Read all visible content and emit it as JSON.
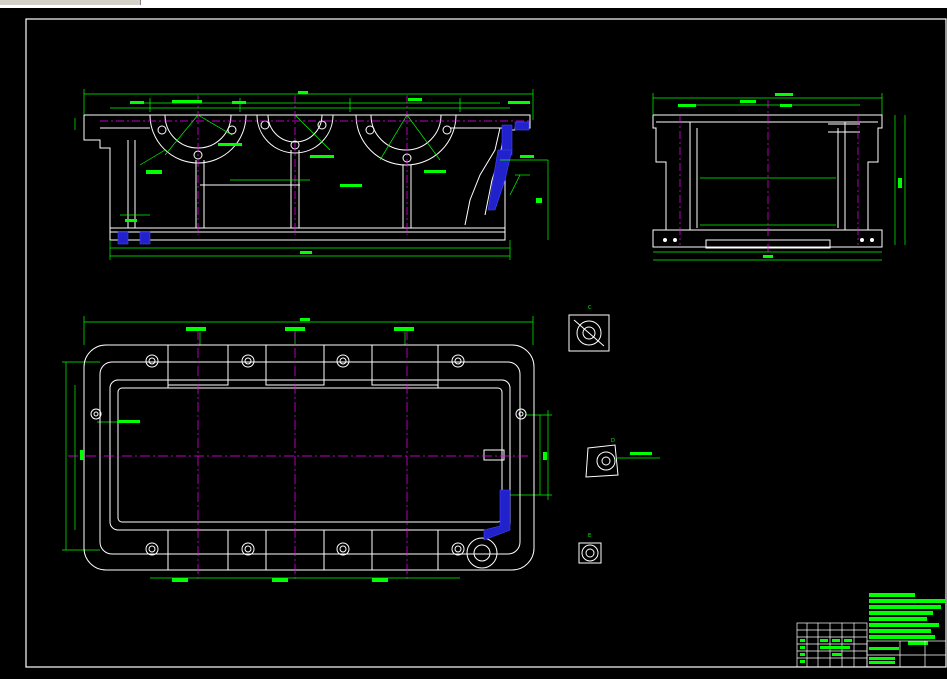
{
  "app": {
    "title": ""
  },
  "drawing": {
    "background": "#000000",
    "colors": {
      "outline": "#ffffff",
      "dimension": "#00ff00",
      "centerline": "#ff00ff",
      "hatch": "#3333ff",
      "callout": "#00ff00"
    },
    "views": {
      "front_view": {
        "name": "front-elevation"
      },
      "side_view": {
        "name": "side-elevation"
      },
      "plan_view": {
        "name": "plan-view"
      },
      "detail_c": {
        "label": "C"
      },
      "detail_d": {
        "label": "D"
      },
      "detail_e": {
        "label": "E"
      }
    }
  },
  "title_block": {
    "grid_label": ""
  }
}
